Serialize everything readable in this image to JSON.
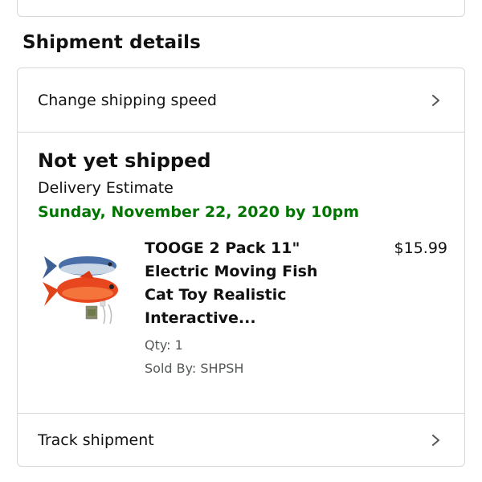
{
  "section": {
    "heading": "Shipment details"
  },
  "links": {
    "change_speed": "Change shipping speed",
    "track": "Track shipment"
  },
  "status": {
    "title": "Not yet shipped",
    "estimate_label": "Delivery Estimate",
    "estimate_date": "Sunday, November 22, 2020 by 10pm"
  },
  "item": {
    "title_lines": [
      "TOOGE 2 Pack 11\"",
      "Electric Moving Fish",
      "Cat Toy Realistic",
      "Interactive..."
    ],
    "price": "$15.99",
    "qty": "Qty: 1",
    "sold_by": "Sold By: SHPSH",
    "image_icon": "product-image-fish-toy"
  },
  "colors": {
    "border": "#d5d9d9",
    "delivery_green": "#007600",
    "text_primary": "#111111",
    "text_secondary": "#565959"
  },
  "icons": {
    "chevron": "chevron-right-icon"
  }
}
